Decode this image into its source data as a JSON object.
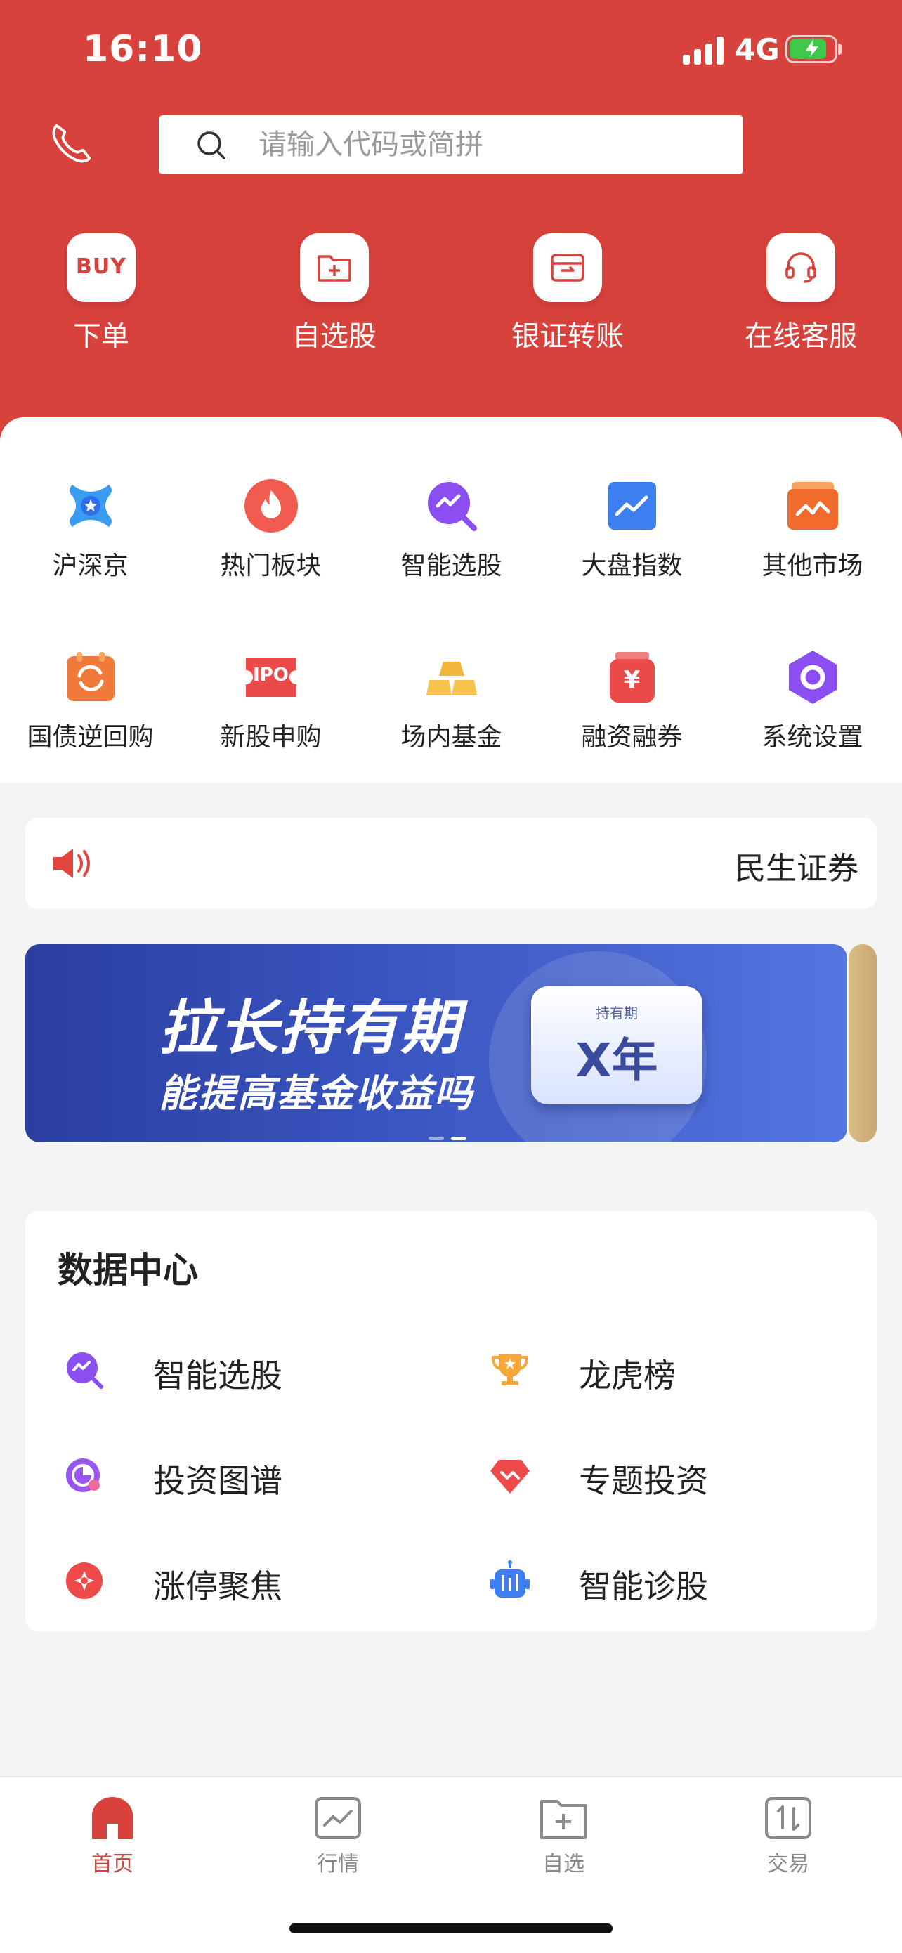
{
  "status_bar": {
    "time": "16:10",
    "network": "4G"
  },
  "search": {
    "placeholder": "请输入代码或简拼"
  },
  "quick_actions": [
    {
      "label": "下单",
      "icon": "buy-icon",
      "icon_text": "BUY"
    },
    {
      "label": "自选股",
      "icon": "folder-plus-icon"
    },
    {
      "label": "银证转账",
      "icon": "wallet-icon"
    },
    {
      "label": "在线客服",
      "icon": "headset-icon"
    }
  ],
  "grid": [
    {
      "label": "沪深京",
      "icon": "star-x-icon"
    },
    {
      "label": "热门板块",
      "icon": "flame-icon"
    },
    {
      "label": "智能选股",
      "icon": "smart-search-icon"
    },
    {
      "label": "大盘指数",
      "icon": "trend-chart-icon"
    },
    {
      "label": "其他市场",
      "icon": "market-icon"
    },
    {
      "label": "国债逆回购",
      "icon": "repo-icon"
    },
    {
      "label": "新股申购",
      "icon": "ipo-icon",
      "icon_text": "IPO"
    },
    {
      "label": "场内基金",
      "icon": "gold-bars-icon"
    },
    {
      "label": "融资融券",
      "icon": "margin-icon",
      "icon_text": "¥"
    },
    {
      "label": "系统设置",
      "icon": "settings-icon"
    }
  ],
  "notice": {
    "text": "民生证券"
  },
  "banner": {
    "line1": "拉长持有期",
    "line2": "能提高基金收益吗",
    "badge_small": "持有期",
    "badge_big": "X年"
  },
  "data_center": {
    "title": "数据中心",
    "items": [
      {
        "label": "智能选股",
        "icon": "smart-search-icon"
      },
      {
        "label": "龙虎榜",
        "icon": "trophy-icon"
      },
      {
        "label": "投资图谱",
        "icon": "graph-icon"
      },
      {
        "label": "专题投资",
        "icon": "diamond-icon"
      },
      {
        "label": "涨停聚焦",
        "icon": "focus-icon"
      },
      {
        "label": "智能诊股",
        "icon": "robot-icon"
      }
    ]
  },
  "tabs": [
    {
      "label": "首页",
      "active": true
    },
    {
      "label": "行情",
      "active": false
    },
    {
      "label": "自选",
      "active": false
    },
    {
      "label": "交易",
      "active": false
    }
  ],
  "colors": {
    "brand_red": "#d8423c",
    "tab_active": "#d8423c",
    "tab_inactive": "#8a8a8a"
  }
}
